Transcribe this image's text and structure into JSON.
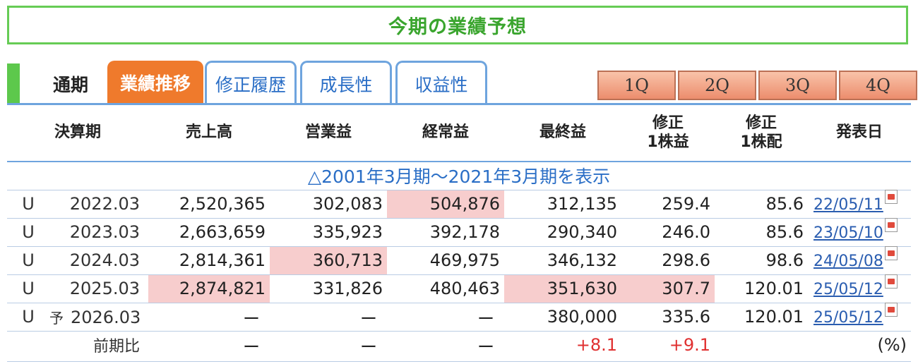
{
  "title": "今期の業績予想",
  "tabs": {
    "current": "通期",
    "items": [
      {
        "label": "業績推移",
        "active": true
      },
      {
        "label": "修正履歴",
        "active": false
      },
      {
        "label": "成長性",
        "active": false
      },
      {
        "label": "収益性",
        "active": false
      }
    ]
  },
  "quarters": [
    "1Q",
    "2Q",
    "3Q",
    "4Q"
  ],
  "table": {
    "headers": {
      "period": "決算期",
      "sales": "売上高",
      "operating": "営業益",
      "ordinary": "経常益",
      "net": "最終益",
      "eps_line1": "修正",
      "eps_line2": "1株益",
      "dps_line1": "修正",
      "dps_line2": "1株配",
      "date": "発表日"
    },
    "toggle_text": "△2001年3月期～2021年3月期を表示",
    "rows": [
      {
        "mark": "U",
        "forecast": "",
        "period": "2022.03",
        "sales": "2,520,365",
        "operating": "302,083",
        "ordinary": "504,876",
        "net": "312,135",
        "eps": "259.4",
        "dps": "85.6",
        "date": "22/05/11"
      },
      {
        "mark": "U",
        "forecast": "",
        "period": "2023.03",
        "sales": "2,663,659",
        "operating": "335,923",
        "ordinary": "392,178",
        "net": "290,340",
        "eps": "246.0",
        "dps": "85.6",
        "date": "23/05/10"
      },
      {
        "mark": "U",
        "forecast": "",
        "period": "2024.03",
        "sales": "2,814,361",
        "operating": "360,713",
        "ordinary": "469,975",
        "net": "346,132",
        "eps": "298.6",
        "dps": "98.6",
        "date": "24/05/08"
      },
      {
        "mark": "U",
        "forecast": "",
        "period": "2025.03",
        "sales": "2,874,821",
        "operating": "331,826",
        "ordinary": "480,463",
        "net": "351,630",
        "eps": "307.7",
        "dps": "120.01",
        "date": "25/05/12"
      },
      {
        "mark": "U",
        "forecast": "予",
        "period": "2026.03",
        "sales": "ー",
        "operating": "ー",
        "ordinary": "ー",
        "net": "380,000",
        "eps": "335.6",
        "dps": "120.01",
        "date": "25/05/12"
      }
    ],
    "compare": {
      "label": "前期比",
      "sales": "ー",
      "operating": "ー",
      "ordinary": "ー",
      "net": "+8.1",
      "eps": "+9.1",
      "unit": "(%)"
    }
  },
  "colors": {
    "title_green": "#3aa52e",
    "tab_active": "#ef7a2c",
    "tab_blue": "#6ea4de",
    "highlight": "#f7cdcd",
    "positive": "#e03030"
  }
}
